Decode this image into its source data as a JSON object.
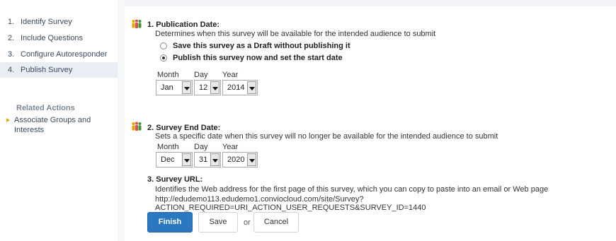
{
  "sidebar": {
    "steps": [
      {
        "num": "1.",
        "label": "Identify Survey"
      },
      {
        "num": "2.",
        "label": "Include Questions"
      },
      {
        "num": "3.",
        "label": "Configure Autoresponder"
      },
      {
        "num": "4.",
        "label": "Publish Survey"
      }
    ],
    "related_title": "Related Actions",
    "related_items": [
      "Associate Groups and Interests"
    ]
  },
  "publication": {
    "title": "1. Publication Date:",
    "description": "Determines when this survey will be available for the intended audience to submit",
    "options": [
      {
        "label": "Save this survey as a Draft without publishing it",
        "checked": false
      },
      {
        "label": "Publish this survey now and set the start date",
        "checked": true
      }
    ],
    "month_label": "Month",
    "day_label": "Day",
    "year_label": "Year",
    "month": "Jan",
    "day": "12",
    "year": "2014"
  },
  "end_date": {
    "title": "2. Survey End Date:",
    "description": "Sets a specific date when this survey will no longer be available for the intended audience to submit",
    "month_label": "Month",
    "day_label": "Day",
    "year_label": "Year",
    "month": "Dec",
    "day": "31",
    "year": "2020"
  },
  "url_section": {
    "title": "3. Survey URL:",
    "description": "Identifies the Web address for the first page of this survey, which you can copy to paste into an email or Web page",
    "url": "http://edudemo113.edudemo1.conviocloud.com/site/Survey?ACTION_REQUIRED=URI_ACTION_USER_REQUESTS&SURVEY_ID=1440"
  },
  "actions": {
    "finish": "Finish",
    "save": "Save",
    "or": "or",
    "cancel": "Cancel"
  },
  "colors": {
    "primary_button": "#2b78c0",
    "active_step_bg": "#e9eef5",
    "related_bullet": "#e0b000"
  }
}
